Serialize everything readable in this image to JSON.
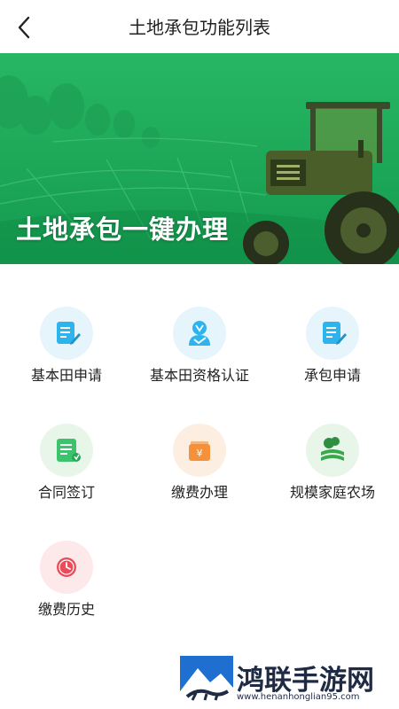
{
  "header": {
    "title": "土地承包功能列表",
    "back_icon": "chevron-left-icon"
  },
  "banner": {
    "headline": "土地承包一键办理",
    "theme_color": "#1fae5a"
  },
  "functions": [
    {
      "label": "基本田申请",
      "icon": "document-edit-icon",
      "bg": "#e6f5fc",
      "fg": "#2eb4ec"
    },
    {
      "label": "基本田资格认证",
      "icon": "user-verify-icon",
      "bg": "#e6f5fc",
      "fg": "#2eb4ec"
    },
    {
      "label": "承包申请",
      "icon": "document-edit-icon",
      "bg": "#e6f5fc",
      "fg": "#2eb4ec"
    },
    {
      "label": "合同签订",
      "icon": "contract-icon",
      "bg": "#e8f6ea",
      "fg": "#3cc46c"
    },
    {
      "label": "缴费办理",
      "icon": "payment-wallet-icon",
      "bg": "#fdeee2",
      "fg": "#f5913a"
    },
    {
      "label": "规模家庭农场",
      "icon": "farm-icon",
      "bg": "#e8f6ea",
      "fg": "#3aa94e"
    },
    {
      "label": "缴费历史",
      "icon": "history-clock-icon",
      "bg": "#fde8ea",
      "fg": "#ec4b5a"
    }
  ],
  "watermark": {
    "text": "鸿联手游网",
    "url": "www.henanhonglian95.com"
  }
}
